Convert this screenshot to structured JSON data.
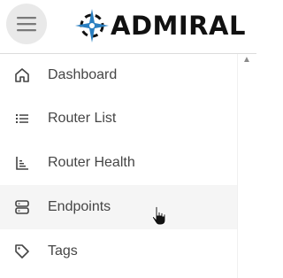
{
  "header": {
    "menu_icon": "hamburger-menu-icon",
    "brand": "ADMIRAL",
    "logo_mark": "compass-star-logo"
  },
  "sidebar": {
    "items": [
      {
        "label": "Dashboard",
        "icon": "home-icon"
      },
      {
        "label": "Router List",
        "icon": "list-icon"
      },
      {
        "label": "Router Health",
        "icon": "bar-chart-icon"
      },
      {
        "label": "Endpoints",
        "icon": "server-icon",
        "hovered": true
      },
      {
        "label": "Tags",
        "icon": "tag-icon"
      }
    ]
  },
  "colors": {
    "hover_background": "#f5f5f5",
    "menu_button_background": "#e9e9e9",
    "label_text": "#454545",
    "logo_blue": "#2a7fc1"
  }
}
